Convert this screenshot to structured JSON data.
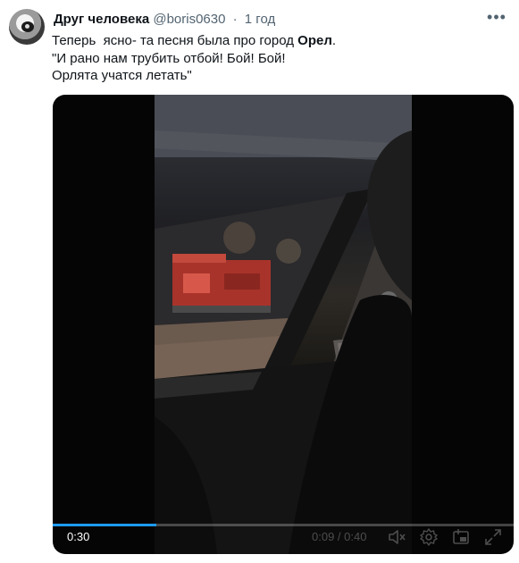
{
  "tweet": {
    "display_name": "Друг человека",
    "handle": "@boris0630",
    "separator": "·",
    "timestamp": "1 год",
    "more_label": "•••",
    "text": {
      "line1_before": "Теперь  ясно- та песня была про город ",
      "line1_bold": "Орел",
      "line1_after": ".",
      "line2": "\"И рано нам трубить отбой! Бой! Бой!",
      "line3": "Орлята учатся летать\""
    }
  },
  "video": {
    "elapsed": "0:30",
    "timecode": "0:09 / 0:40",
    "progress": 0.225,
    "accent_color": "#1d9bf0",
    "controls": [
      "volume-icon",
      "settings-icon",
      "pip-icon",
      "fullscreen-icon"
    ]
  }
}
